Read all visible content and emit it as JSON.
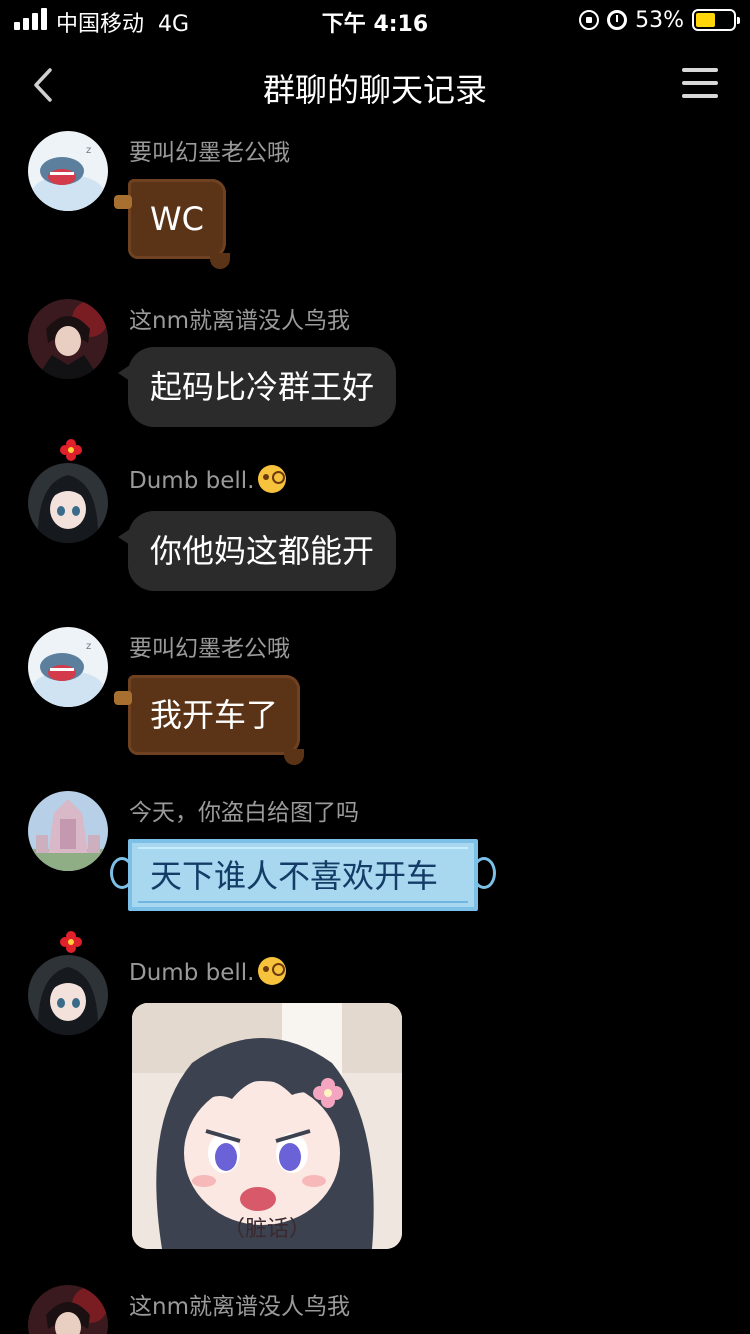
{
  "status_bar": {
    "carrier": "中国移动",
    "network": "4G",
    "time": "下午 4:16",
    "battery_percent": "53%",
    "battery_level": 0.53,
    "battery_color": "#ffd60a"
  },
  "nav": {
    "title": "群聊的聊天记录",
    "back_icon": "chevron-left-icon",
    "menu_icon": "hamburger-menu-icon"
  },
  "messages": [
    {
      "sender": "要叫幻墨老公哦",
      "text": "WC",
      "style": "chocolate-bubble"
    },
    {
      "sender": "这nm就离谱没人鸟我",
      "text": "起码比冷群王好",
      "style": "plain-bubble"
    },
    {
      "sender": "Dumb bell.",
      "sender_emoji": "monocle-face-icon",
      "text": "你他妈这都能开",
      "style": "plain-bubble"
    },
    {
      "sender": "要叫幻墨老公哦",
      "text": "我开车了",
      "style": "chocolate-bubble"
    },
    {
      "sender": "今天，你盗白给图了吗",
      "text": "天下谁人不喜欢开车",
      "style": "face-mask-bubble"
    },
    {
      "sender": "Dumb bell.",
      "sender_emoji": "monocle-face-icon",
      "sticker_caption": "（脏话）",
      "style": "image-sticker"
    },
    {
      "sender": "这nm就离谱没人鸟我"
    }
  ]
}
